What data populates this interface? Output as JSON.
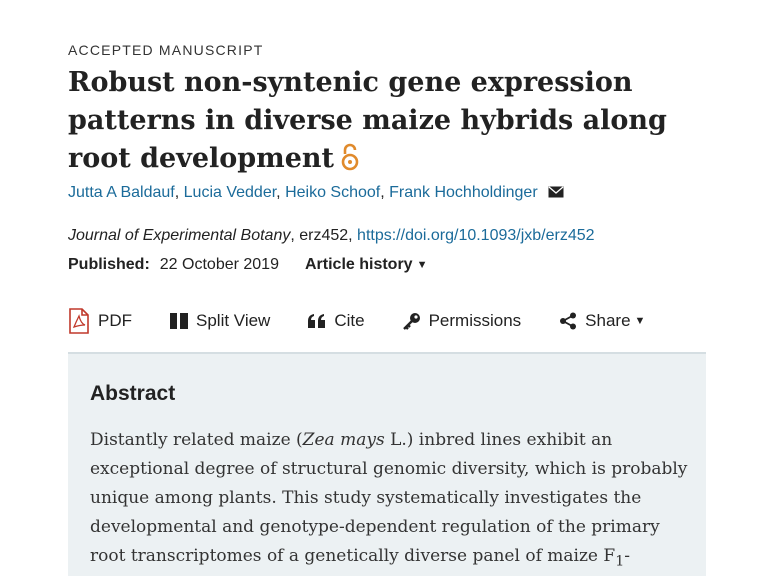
{
  "header": {
    "manuscript_label": "ACCEPTED MANUSCRIPT",
    "title": "Robust non-syntenic gene expression patterns in diverse maize hybrids along root development"
  },
  "authors": [
    "Jutta A Baldauf",
    "Lucia Vedder",
    "Heiko Schoof",
    "Frank Hochholdinger"
  ],
  "citation": {
    "journal": "Journal of Experimental Botany",
    "article_id": ", erz452, ",
    "doi": "https://doi.org/10.1093/jxb/erz452"
  },
  "published": {
    "label": "Published:",
    "date": "22 October 2019",
    "history_label": "Article history"
  },
  "toolbar": {
    "pdf": "PDF",
    "split_view": "Split View",
    "cite": "Cite",
    "permissions": "Permissions",
    "share": "Share"
  },
  "abstract": {
    "heading": "Abstract",
    "text_before_species": "Distantly related maize (",
    "species": "Zea mays",
    "text_after_species": " L.) inbred lines exhibit an exceptional degree of structural genomic diversity, which is probably unique among plants. This study systematically investigates the developmental and genotype-dependent regulation of the primary root transcriptomes of a genetically diverse panel of maize F",
    "subscript": "1",
    "text_tail": "-"
  },
  "colors": {
    "link": "#1b6b9a",
    "open_access": "#e08a2c",
    "pdf_icon": "#c0392b",
    "abstract_bg": "#ecf1f3"
  }
}
